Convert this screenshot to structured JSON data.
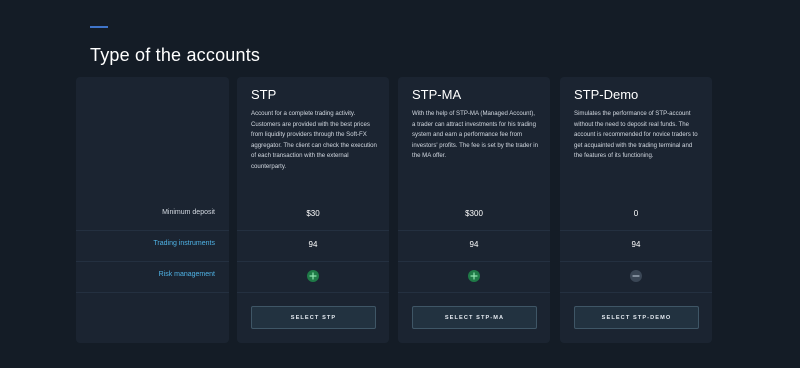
{
  "page": {
    "title": "Type of the accounts"
  },
  "row_labels": {
    "min_deposit": "Minimum deposit",
    "instruments": "Trading instruments",
    "risk": "Risk management"
  },
  "plans": [
    {
      "name": "STP",
      "description": "Account for a complete trading activity. Customers are provided with the best prices from liquidity providers through the Soft-FX aggregator. The client can check the execution of each transaction with the external counterparty.",
      "min_deposit": "$30",
      "instruments": "94",
      "risk_management": "plus-icon",
      "button": "SELECT STP"
    },
    {
      "name": "STP-MA",
      "description": "With the help of STP-MA (Managed Account), a trader can attract investments for his trading system and earn a performance fee from investors' profits. The fee is set by the trader in the MA offer.",
      "min_deposit": "$300",
      "instruments": "94",
      "risk_management": "plus-icon",
      "button": "SELECT STP-MA"
    },
    {
      "name": "STP-Demo",
      "description": "Simulates the performance of STP-account without the need to deposit real funds. The account is recommended for novice traders to get acquainted with the trading terminal and the features of its functioning.",
      "min_deposit": "0",
      "instruments": "94",
      "risk_management": "minus-icon",
      "button": "SELECT STP-DEMO"
    }
  ],
  "colors": {
    "background": "#141c26",
    "card": "#1b2431",
    "accent": "#3f74c9",
    "link": "#4fb3e6",
    "positive": "#1f7a47",
    "neutral": "#3a4655"
  }
}
